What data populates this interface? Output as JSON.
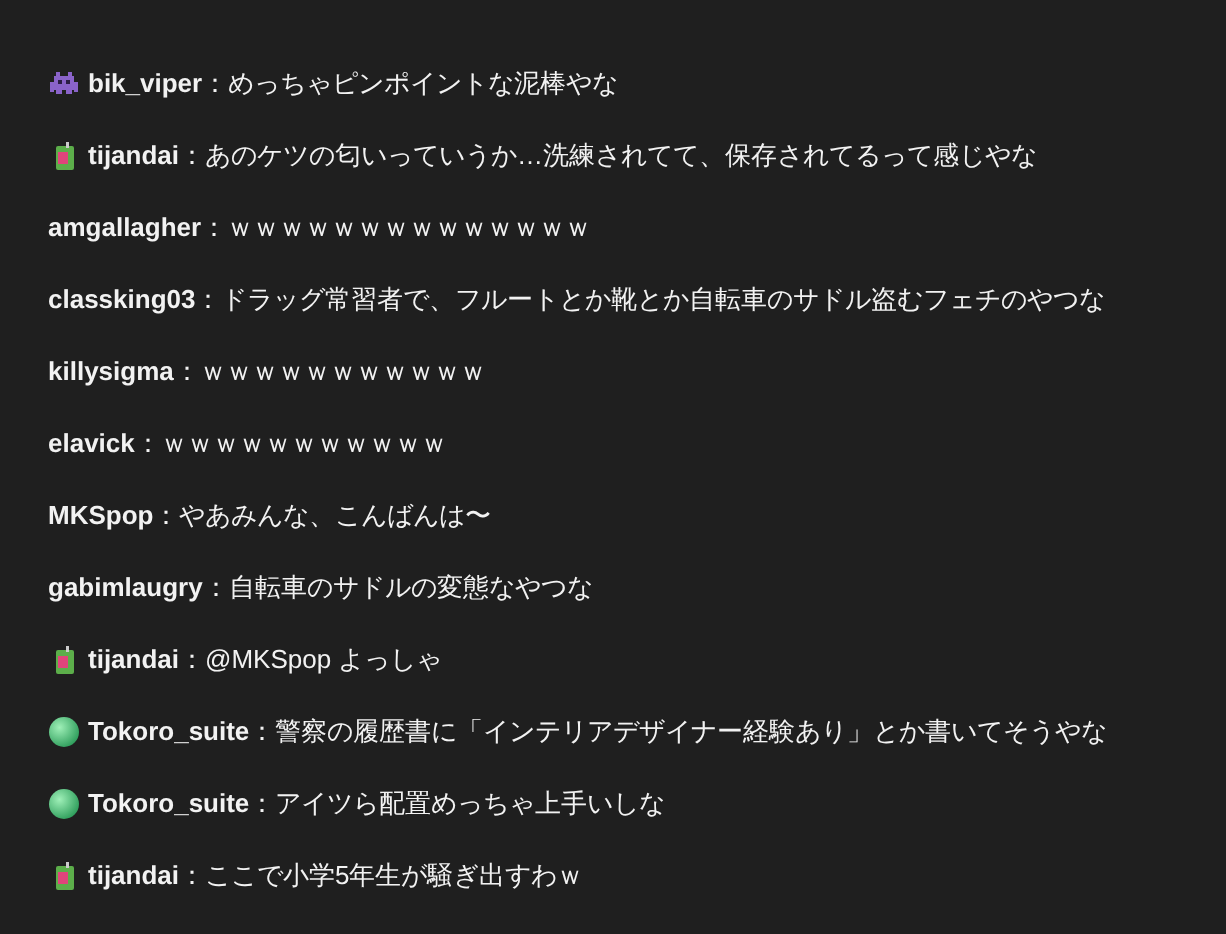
{
  "messages": [
    {
      "kind": "invader",
      "user": "bik_viper",
      "sep": "：",
      "text": "めっちゃピンポイントな泥棒やな"
    },
    {
      "kind": "juice",
      "user": "tijandai",
      "sep": "：",
      "text": "あのケツの匂いっていうか…洗練されてて、保存されてるって感じやな"
    },
    {
      "user": "amgallagher",
      "sep": "：",
      "text": "ｗｗｗｗｗｗｗｗｗｗｗｗｗｗ"
    },
    {
      "user": "classking03",
      "sep": "：",
      "text": "ドラッグ常習者で、フルートとか靴とか自転車のサドル盗むフェチのやつな"
    },
    {
      "user": "killysigma",
      "sep": "：",
      "text": "ｗｗｗｗｗｗｗｗｗｗｗ"
    },
    {
      "user": "elavick",
      "sep": "：",
      "text": "ｗｗｗｗｗｗｗｗｗｗｗ"
    },
    {
      "user": "MKSpop",
      "sep": "：",
      "text": "やあみんな、こんばんは〜"
    },
    {
      "user": "gabimlaugry",
      "sep": "：",
      "text": "自転車のサドルの変態なやつな"
    },
    {
      "kind": "juice",
      "user": "tijandai",
      "sep": "：",
      "text": "@MKSpop よっしゃ"
    },
    {
      "kind": "orb",
      "user": "Tokoro_suite",
      "sep": "：",
      "text": "警察の履歴書に「インテリアデザイナー経験あり」とか書いてそうやな"
    },
    {
      "kind": "orb",
      "user": "Tokoro_suite",
      "sep": "：",
      "text": "アイツら配置めっちゃ上手いしな"
    },
    {
      "kind": "juice",
      "user": "tijandai",
      "sep": "：",
      "text": "ここで小学5年生が騒ぎ出すわｗ"
    }
  ]
}
